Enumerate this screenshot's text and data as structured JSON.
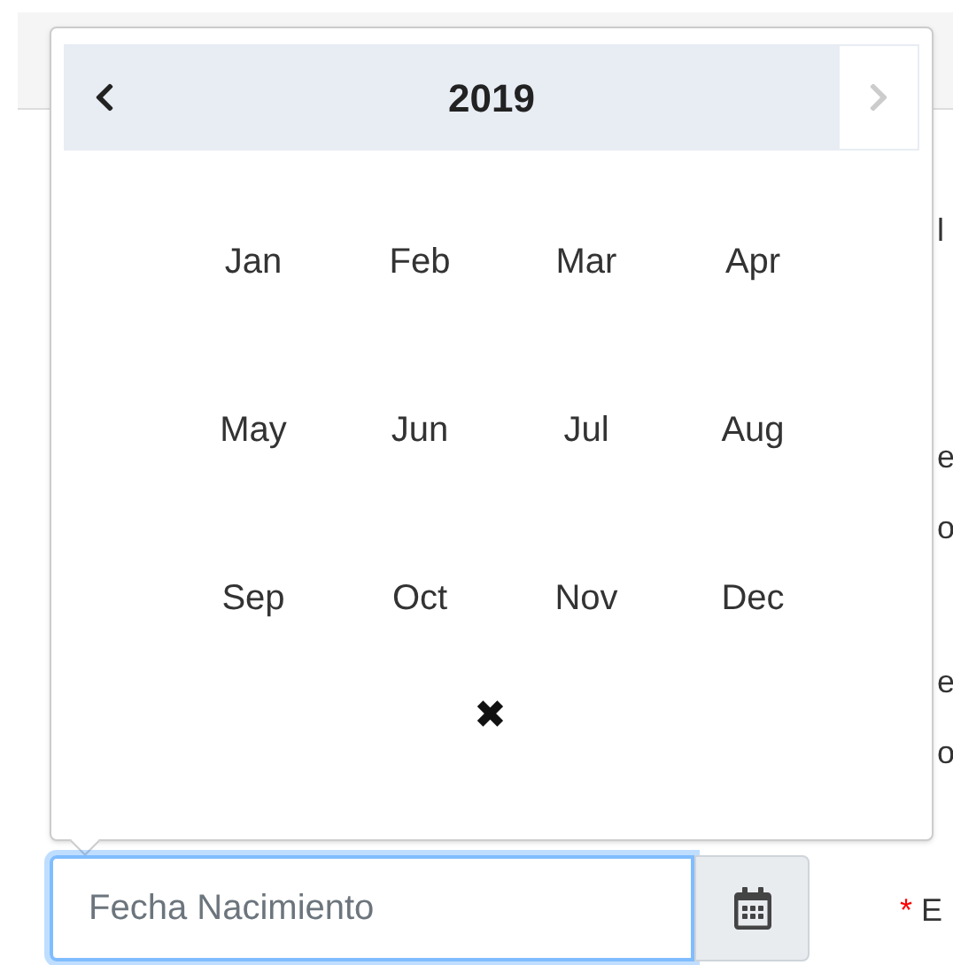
{
  "month_picker": {
    "year": "2019",
    "prev_button": {
      "disabled": false
    },
    "next_button": {
      "disabled": true
    },
    "months": [
      "Jan",
      "Feb",
      "Mar",
      "Apr",
      "May",
      "Jun",
      "Jul",
      "Aug",
      "Sep",
      "Oct",
      "Nov",
      "Dec"
    ],
    "clear_button": "✖"
  },
  "date_field": {
    "placeholder": "Fecha Nacimiento",
    "focused": true
  },
  "background_text": [
    "l",
    "e",
    "o",
    "e",
    "o"
  ],
  "required_label": {
    "mark": "*",
    "text": "E"
  }
}
